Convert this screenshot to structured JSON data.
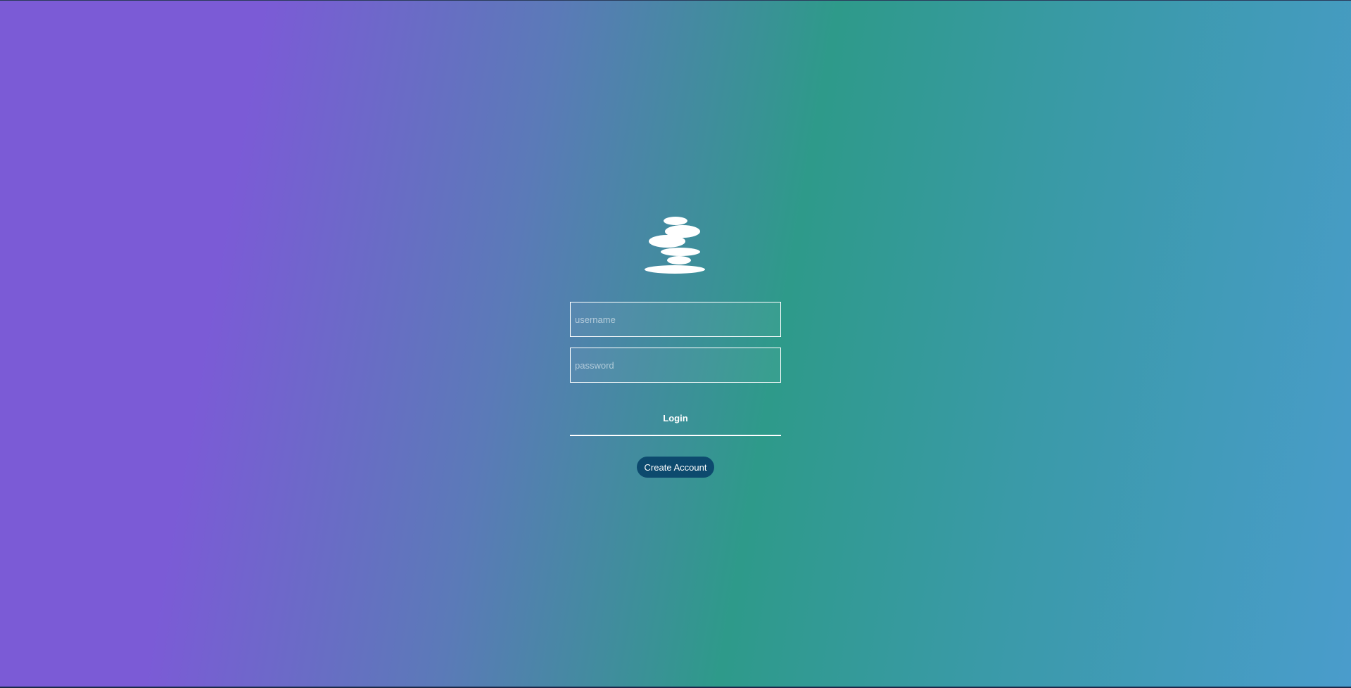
{
  "login": {
    "username_placeholder": "username",
    "password_placeholder": "password",
    "login_label": "Login",
    "create_account_label": "Create Account"
  },
  "logo": {
    "icon": "stacked-stones-icon",
    "color": "#ffffff"
  },
  "colors": {
    "gradient_start": "#7b5bd6",
    "gradient_mid": "#2e9a8a",
    "gradient_end": "#4a9ccc",
    "create_button_bg": "#0d4a6e"
  }
}
